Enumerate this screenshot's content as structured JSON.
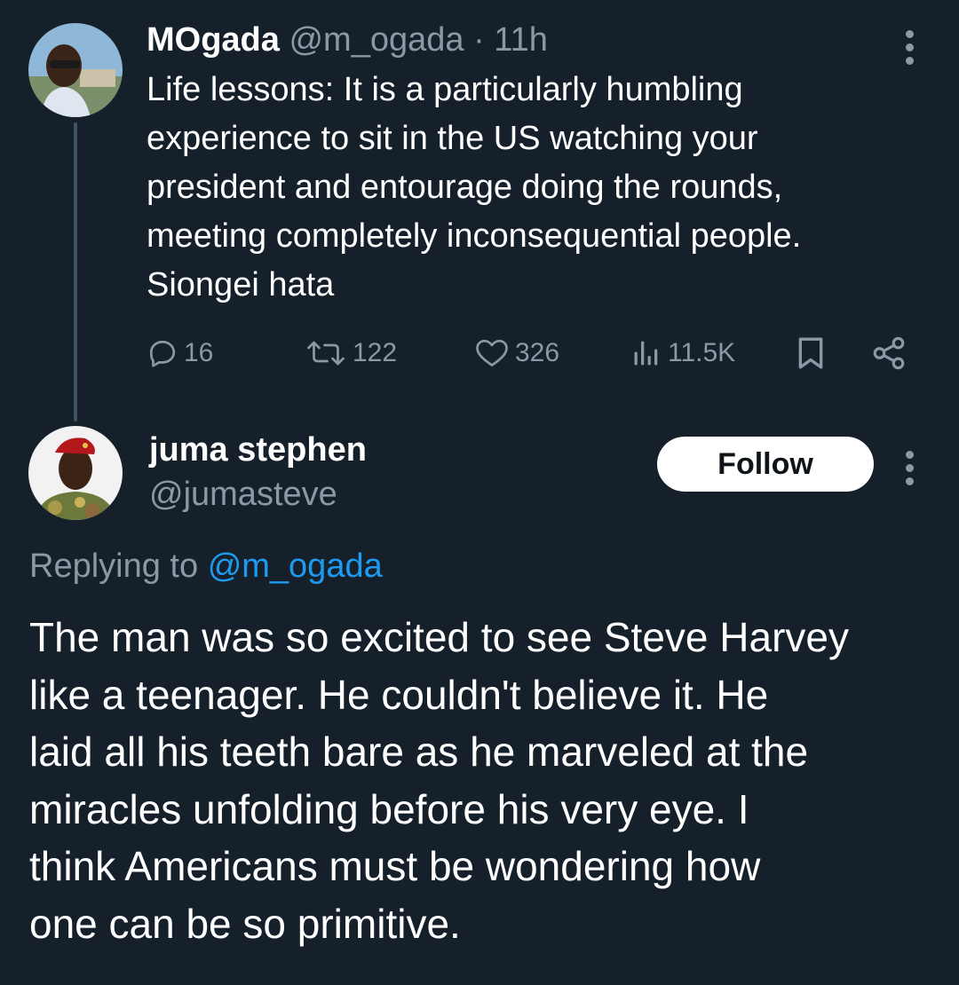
{
  "original_tweet": {
    "display_name": "MOgada",
    "handle": "@m_ogada",
    "separator": "·",
    "time": "11h",
    "text": "Life lessons: It is a particularly humbling\nexperience  to sit  in the US watching your\npresident and entourage doing the rounds,\nmeeting completely inconsequential people.\nSiongei hata",
    "stats": {
      "replies": "16",
      "retweets": "122",
      "likes": "326",
      "views": "11.5K"
    }
  },
  "reply_tweet": {
    "display_name": "juma stephen",
    "handle": "@jumasteve",
    "follow_label": "Follow",
    "replying_prefix": "Replying to",
    "replying_to": "@m_ogada",
    "text": "The man was so excited to see Steve Harvey\nlike a teenager. He couldn't believe it. He\nlaid all his teeth bare as he marveled at the\nmiracles unfolding before his very eye. I\nthink Americans must be wondering how\none can be so primitive."
  },
  "icons": {
    "reply": "reply-icon",
    "retweet": "retweet-icon",
    "like": "heart-icon",
    "views": "views-icon",
    "bookmark": "bookmark-icon",
    "share": "share-icon",
    "more": "more-vertical-icon"
  },
  "colors": {
    "background": "#15202b",
    "text_primary": "#ffffff",
    "text_secondary": "#8b98a5",
    "accent": "#1d9bf0",
    "thread_line": "#3d5466"
  }
}
